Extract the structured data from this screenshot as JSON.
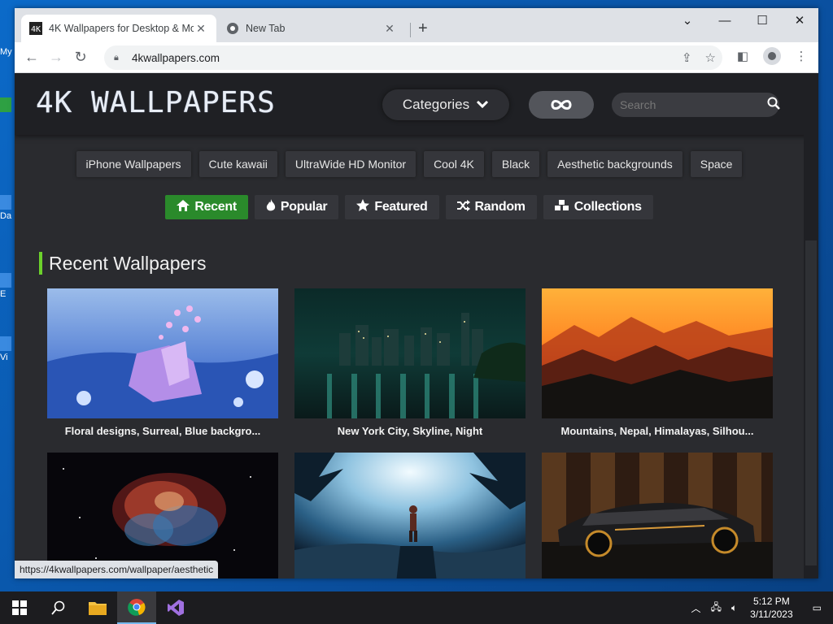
{
  "desktop": {
    "icons": [
      "My",
      "Da",
      "E",
      "Vi"
    ]
  },
  "browser": {
    "tabs": [
      {
        "title": "4K Wallpapers for Desktop & Mo",
        "active": true
      },
      {
        "title": "New Tab",
        "active": false
      }
    ],
    "url": "4kwallpapers.com",
    "status_url": "https://4kwallpapers.com/wallpaper/aesthetic"
  },
  "site": {
    "logo": "4K WALLPAPERS",
    "categories_label": "Categories",
    "infinite_icon": "infinity-icon",
    "search_placeholder": "Search",
    "tags": [
      "iPhone Wallpapers",
      "Cute kawaii",
      "UltraWide HD Monitor",
      "Cool 4K",
      "Black",
      "Aesthetic backgrounds",
      "Space"
    ],
    "filters": [
      {
        "label": "Recent",
        "icon": "home-icon",
        "active": true
      },
      {
        "label": "Popular",
        "icon": "fire-icon",
        "active": false
      },
      {
        "label": "Featured",
        "icon": "star-icon",
        "active": false
      },
      {
        "label": "Random",
        "icon": "shuffle-icon",
        "active": false
      },
      {
        "label": "Collections",
        "icon": "cubes-icon",
        "active": false
      }
    ],
    "section_title": "Recent Wallpapers",
    "wallpapers": [
      {
        "caption": "Floral designs, Surreal, Blue backgro...",
        "palette": [
          "#8fb3e6",
          "#2f59b8",
          "#c59af0"
        ]
      },
      {
        "caption": "New York City, Skyline, Night",
        "palette": [
          "#0b2c2a",
          "#1d5c54",
          "#f1e8b0"
        ]
      },
      {
        "caption": "Mountains, Nepal, Himalayas, Silhou...",
        "palette": [
          "#ff9a2a",
          "#c43f1d",
          "#14120f"
        ]
      },
      {
        "caption": "",
        "palette": [
          "#08070c",
          "#a33a2a",
          "#3d7bb0"
        ]
      },
      {
        "caption": "",
        "palette": [
          "#cfe7f2",
          "#3a7ea8",
          "#0b1a28"
        ]
      },
      {
        "caption": "",
        "palette": [
          "#3a2418",
          "#8a5a32",
          "#151515"
        ]
      }
    ],
    "accent_green": "#2a8a2b",
    "section_bar_color": "#6cd12b"
  },
  "taskbar": {
    "time": "5:12 PM",
    "date": "3/11/2023"
  }
}
